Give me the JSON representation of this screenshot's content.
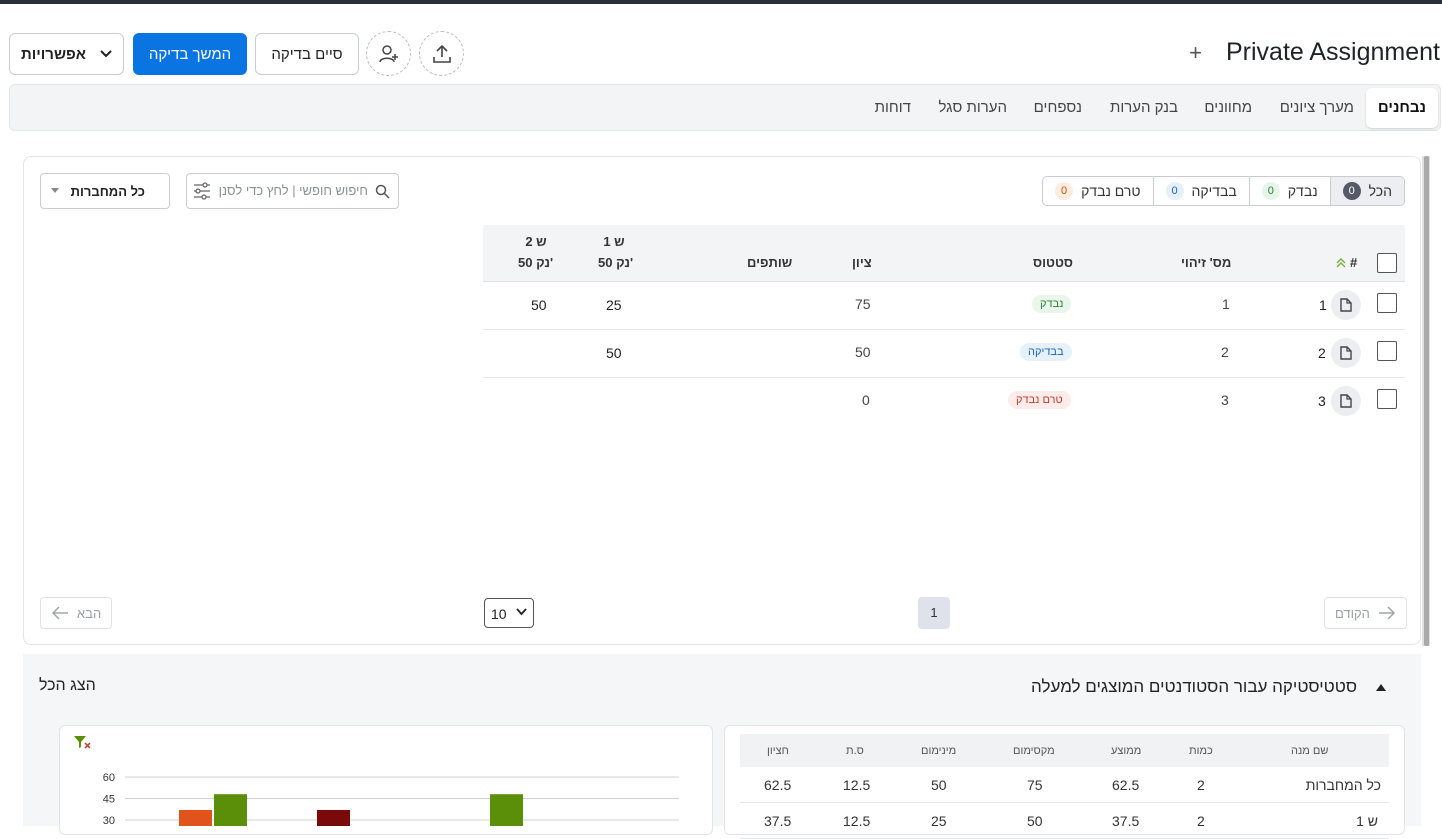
{
  "header": {
    "title": "Private Assignment",
    "plus": "+",
    "options_label": "אפשרויות",
    "continue_label": "המשך בדיקה",
    "finish_label": "סיים בדיקה"
  },
  "tabs": [
    {
      "label": "נבחנים",
      "active": true
    },
    {
      "label": "מערך ציונים"
    },
    {
      "label": "מחוונים"
    },
    {
      "label": "בנק הערות"
    },
    {
      "label": "נספחים"
    },
    {
      "label": "הערות סגל"
    },
    {
      "label": "דוחות"
    }
  ],
  "filters": [
    {
      "label": "הכל",
      "count": "0"
    },
    {
      "label": "נבדק",
      "count": "0"
    },
    {
      "label": "בבדיקה",
      "count": "0"
    },
    {
      "label": "טרם נבדק",
      "count": "0"
    }
  ],
  "search": {
    "placeholder": "חיפוש חופשי | לחץ כדי לסנן"
  },
  "notebook_select": {
    "value": "כל המחברות"
  },
  "table": {
    "headers": {
      "num": "#",
      "id": "מס' זיהוי",
      "status": "סטטוס",
      "grade": "ציון",
      "partners": "שותפים",
      "q1_name": "ש 1",
      "q1_pts": "50 נק'",
      "q2_name": "ש 2",
      "q2_pts": "50 נק'"
    },
    "rows": [
      {
        "num": "1",
        "id": "1",
        "status": "נבדק",
        "grade": "75",
        "partners": "",
        "q1": "25",
        "q2": "50"
      },
      {
        "num": "2",
        "id": "2",
        "status": "בבדיקה",
        "grade": "50",
        "partners": "",
        "q1": "50",
        "q2": ""
      },
      {
        "num": "3",
        "id": "3",
        "status": "טרם נבדק",
        "grade": "0",
        "partners": "",
        "q1": "",
        "q2": ""
      }
    ]
  },
  "pagination": {
    "prev": "הקודם",
    "next": "הבא",
    "page": "1",
    "per_page": "10"
  },
  "stats": {
    "title": "סטטיסטיקה עבור הסטודנטים המוצגים למעלה",
    "show_all": "הצג הכל",
    "headers": {
      "name": "שם מנה",
      "count": "כמות",
      "avg": "ממוצע",
      "max": "מקסימום",
      "min": "מינימום",
      "sd": "ס.ת",
      "median": "חציון"
    },
    "rows": [
      {
        "name": "כל המחברות",
        "count": "2",
        "avg": "62.5",
        "max": "75",
        "min": "50",
        "sd": "12.5",
        "median": "62.5"
      },
      {
        "name": "ש 1",
        "count": "2",
        "avg": "37.5",
        "max": "50",
        "min": "25",
        "sd": "12.5",
        "median": "37.5"
      }
    ]
  },
  "chart_data": {
    "type": "bar",
    "yticks": [
      "60",
      "45",
      "30"
    ],
    "ylim": [
      0,
      60
    ],
    "groups": [
      {
        "bars": [
          {
            "value": 37,
            "color": "#e0531b"
          },
          {
            "value": 48,
            "color": "#5b8f0a"
          }
        ]
      },
      {
        "bars": [
          {
            "value": 37,
            "color": "#7a0a0a"
          }
        ]
      },
      {
        "bars": [
          {
            "value": 48,
            "color": "#5b8f0a"
          }
        ]
      }
    ]
  },
  "colors": {
    "primary": "#0a74e3",
    "checked": "#2e7d32",
    "checking": "#1565c0",
    "pending": "#c0392b"
  }
}
